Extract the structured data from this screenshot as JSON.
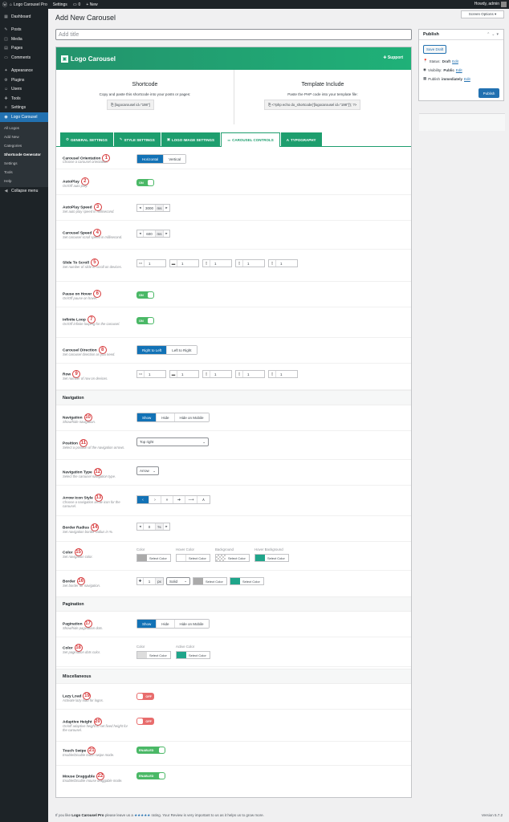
{
  "adminbar": {
    "site": "Logo Carousel Pro",
    "settings": "Settings",
    "comments": "0",
    "new": "+ New",
    "howdy": "Howdy, admin"
  },
  "sidebar": {
    "items": [
      {
        "icon": "▦",
        "label": "Dashboard"
      },
      {
        "icon": "✎",
        "label": "Posts"
      },
      {
        "icon": "◫",
        "label": "Media"
      },
      {
        "icon": "▤",
        "label": "Pages"
      },
      {
        "icon": "▭",
        "label": "Comments"
      },
      {
        "icon": "✦",
        "label": "Appearance"
      },
      {
        "icon": "⚙",
        "label": "Plugins"
      },
      {
        "icon": "☺",
        "label": "Users"
      },
      {
        "icon": "✚",
        "label": "Tools"
      },
      {
        "icon": "≡",
        "label": "Settings"
      },
      {
        "icon": "◉",
        "label": "Logo Carousel"
      }
    ],
    "sub": [
      "All Logos",
      "Add New",
      "Categories",
      "Shortcode Generator",
      "Settings",
      "Tools",
      "Help"
    ],
    "collapse": "Collapse menu"
  },
  "page": {
    "title": "Add New Carousel",
    "screen_options": "Screen Options ▾",
    "title_placeholder": "Add title"
  },
  "publish": {
    "title": "Publish",
    "save_draft": "Save Draft",
    "status_label": "Status:",
    "status_value": "Draft",
    "visibility_label": "Visibility:",
    "visibility_value": "Public",
    "publish_label": "Publish",
    "publish_value": "immediately",
    "edit": "Edit",
    "publish_btn": "Publish"
  },
  "banner": {
    "title": "Logo Carousel",
    "support": "Support"
  },
  "shortcode": {
    "title": "Shortcode",
    "desc": "Copy and paste this shortcode into your posts or pages:",
    "code": "[logocarousel id=\"198\"]"
  },
  "template": {
    "title": "Template Include",
    "desc": "Paste the PHP code into your template file:",
    "code": "<?php echo do_shortcode('[logocarousel id=\"198\"]'); ?>"
  },
  "tabs": [
    "GENERAL SETTINGS",
    "STYLE SETTINGS",
    "LOGO IMAGE SETTINGS",
    "CAROUSEL CONTROLS",
    "TYPOGRAPHY"
  ],
  "fields": {
    "orientation": {
      "label": "Carousel Orientation",
      "n": "1",
      "desc": "Choose a carousel orientation.",
      "opts": [
        "Horizontal",
        "Vertical"
      ]
    },
    "autoplay": {
      "label": "AutoPlay",
      "n": "2",
      "desc": "On/Off auto play.",
      "toggle": "ON"
    },
    "autoplay_speed": {
      "label": "AutoPlay Speed",
      "n": "3",
      "desc": "Set auto play speed in millisecond.",
      "value": "3000",
      "unit": "ms"
    },
    "carousel_speed": {
      "label": "Carousel Speed",
      "n": "4",
      "desc": "Set carousel scroll speed in millisecond.",
      "value": "600",
      "unit": "ms"
    },
    "slide_scroll": {
      "label": "Slide To Scroll",
      "n": "5",
      "desc": "Set number of slide to scroll on devices.",
      "values": [
        "1",
        "1",
        "1",
        "1",
        "1"
      ]
    },
    "pause_hover": {
      "label": "Pause on Hover",
      "n": "6",
      "desc": "On/Off pause on hover.",
      "toggle": "ON"
    },
    "infinite": {
      "label": "Infinite Loop",
      "n": "7",
      "desc": "On/Off infinite looping for the carousel.",
      "toggle": "ON"
    },
    "direction": {
      "label": "Carousel Direction",
      "n": "8",
      "desc": "Set carousel direction as you need.",
      "opts": [
        "Right to Left",
        "Left to Right"
      ]
    },
    "row": {
      "label": "Row",
      "n": "9",
      "desc": "Set number of row on devices.",
      "values": [
        "1",
        "1",
        "1",
        "1",
        "1"
      ]
    }
  },
  "nav_section": "Navigation",
  "nav": {
    "navigation": {
      "label": "Navigation",
      "n": "10",
      "desc": "Show/hide navigation.",
      "opts": [
        "Show",
        "Hide",
        "Hide on Mobile"
      ]
    },
    "position": {
      "label": "Position",
      "n": "11",
      "desc": "Select a position of the navigation arrows.",
      "value": "Top right"
    },
    "type": {
      "label": "Navigation Type",
      "n": "12",
      "desc": "Select the carousel navigation type.",
      "value": "Arrow"
    },
    "arrow": {
      "label": "Arrow Icon Style",
      "n": "13",
      "desc": "Choose a navigation arrow icon for the carousel.",
      "icons": [
        "‹",
        "›",
        "»",
        "➔",
        "⟶",
        "∧"
      ]
    },
    "radius": {
      "label": "Border Radius",
      "n": "14",
      "desc": "Set navigation border radius in %.",
      "value": "0",
      "unit": "%"
    },
    "color": {
      "label": "Color",
      "n": "15",
      "desc": "Set navigation color.",
      "labels": [
        "Color",
        "Hover Color",
        "Background",
        "Hover Background"
      ],
      "btn": "Select Color",
      "swatches": [
        "#aaaaaa",
        "#ffffff",
        "checker",
        "#1fa58a"
      ]
    },
    "border": {
      "label": "Border",
      "n": "16",
      "desc": "Set border for navigation.",
      "value": "1",
      "unit": "px",
      "style": "Solid",
      "swatches": [
        "#aaaaaa",
        "#1fa58a"
      ],
      "btn": "Select Color"
    }
  },
  "pag_section": "Pagination",
  "pag": {
    "pagination": {
      "label": "Pagination",
      "n": "17",
      "desc": "Show/hide pagination dots.",
      "opts": [
        "Show",
        "Hide",
        "Hide on Mobile"
      ]
    },
    "color": {
      "label": "Color",
      "n": "18",
      "desc": "Set pagination dots color.",
      "labels": [
        "Color",
        "Active Color"
      ],
      "btn": "Select Color",
      "swatches": [
        "#dddddd",
        "#1fa58a"
      ]
    }
  },
  "misc_section": "Miscellaneous",
  "misc": {
    "lazy": {
      "label": "Lazy Load",
      "n": "19",
      "desc": "Activate lazy load for logos.",
      "toggle": "OFF"
    },
    "adaptive": {
      "label": "Adaptive Height",
      "n": "20",
      "desc": "On/off adaptive height to set fixed height for the carousel.",
      "toggle": "OFF"
    },
    "touch": {
      "label": "Touch Swipe",
      "n": "21",
      "desc": "Enable/Disable touch swipe mode.",
      "toggle": "ENABLED"
    },
    "drag": {
      "label": "Mouse Draggable",
      "n": "22",
      "desc": "Enable/Disable mouse draggable mode.",
      "toggle": "ENABLED"
    }
  },
  "footer": {
    "pre": "If you like",
    "name": "Logo Carousel Pro",
    "mid": "please leave us a",
    "stars": "★★★★★",
    "post": "rating. Your Review is very important to us as it helps us to grow more.",
    "version": "Version 5.7.2"
  }
}
